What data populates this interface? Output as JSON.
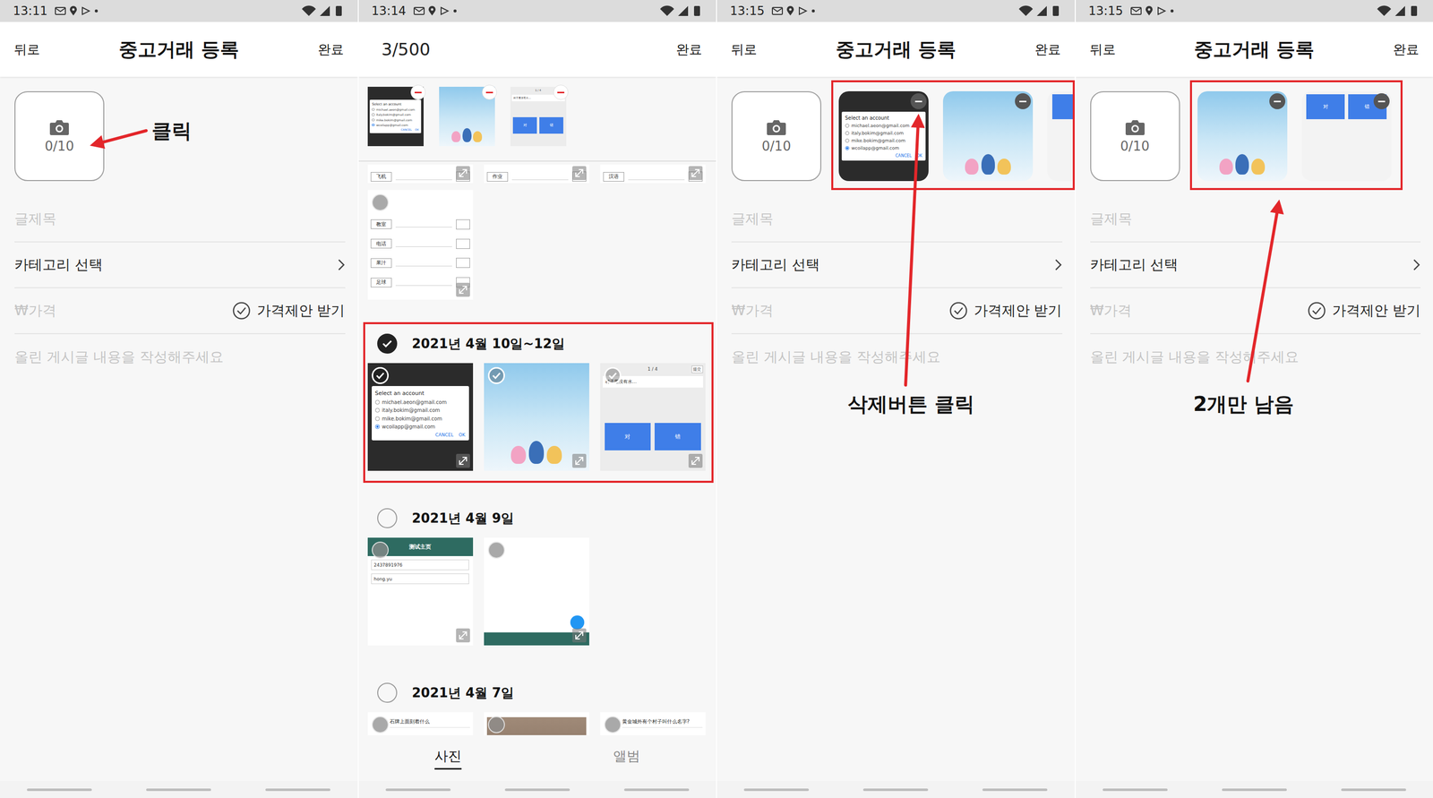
{
  "screens": [
    {
      "kind": "form",
      "status_time": "13:11",
      "header": {
        "back": "뒤로",
        "title": "중고거래 등록",
        "done": "완료"
      },
      "photo_button": {
        "count": "0/10"
      },
      "attached": {
        "highlighted": false,
        "items": []
      },
      "form": {
        "title_placeholder": "글제목",
        "category": "카테고리 선택",
        "price_placeholder": "₩가격",
        "offer": {
          "label": "가격제안 받기",
          "checked": false
        },
        "content_placeholder": "올린 게시글 내용을 작성해주세요"
      },
      "annotation": {
        "text": "클릭"
      }
    },
    {
      "kind": "picker",
      "status_time": "13:14",
      "header": {
        "count": "3/500",
        "done": "완료"
      },
      "selected_strip": [
        {
          "kind": "account",
          "title": "Select an account",
          "options": [
            {
              "label": "michael.aeon@gmail.com",
              "selected": false
            },
            {
              "label": "italy.bokim@gmail.com",
              "selected": false
            },
            {
              "label": "mike.bokim@gmail.com",
              "selected": false
            },
            {
              "label": "wcoilapp@gmail.com",
              "selected": true
            }
          ],
          "buttons": [
            "CANCEL",
            "OK"
          ]
        },
        {
          "kind": "image"
        },
        {
          "kind": "quiz",
          "page": "1 / 4",
          "submit": "提交",
          "question": "村子里没有水…",
          "answers": [
            "对",
            "错"
          ]
        }
      ],
      "partial_row": [
        {
          "kind": "words",
          "words": [
            "飞机"
          ]
        },
        {
          "kind": "words",
          "words": [
            "作业"
          ]
        },
        {
          "kind": "words",
          "words": [
            "汉语"
          ]
        }
      ],
      "tall_photo": {
        "kind": "words",
        "words": [
          "教室",
          "电话",
          "果汁",
          "足球"
        ],
        "selected": false
      },
      "groups": [
        {
          "title": "2021년 4월 10일~12일",
          "selected": true,
          "highlighted": true,
          "photos": [
            {
              "kind": "account",
              "title": "Select an account",
              "options": [
                {
                  "label": "michael.aeon@gmail.com",
                  "selected": false
                },
                {
                  "label": "italy.bokim@gmail.com",
                  "selected": false
                },
                {
                  "label": "mike.bokim@gmail.com",
                  "selected": false
                },
                {
                  "label": "wcoilapp@gmail.com",
                  "selected": true
                }
              ],
              "buttons": [
                "CANCEL",
                "OK"
              ],
              "selected": true
            },
            {
              "kind": "image",
              "selected": true
            },
            {
              "kind": "quiz",
              "page": "1 / 4",
              "submit": "提交",
              "question": "村子里没有水…",
              "answers": [
                "对",
                "错"
              ],
              "selected": true
            }
          ]
        },
        {
          "title": "2021년 4월 9일",
          "selected": false,
          "highlighted": false,
          "photos": [
            {
              "kind": "app-form",
              "title": "测试主页",
              "fields": [
                "2437891976",
                "hong.yu"
              ],
              "selected": false
            },
            {
              "kind": "app-blank",
              "selected": false
            }
          ]
        },
        {
          "title": "2021년 4월 7일",
          "selected": false,
          "highlighted": false,
          "photos": [
            {
              "kind": "question",
              "text": "石牌上面刻着什么",
              "selected": false
            },
            {
              "kind": "photo",
              "selected": false
            },
            {
              "kind": "question",
              "text": "黄金城外有个村子叫什么名字?",
              "selected": false
            }
          ]
        }
      ],
      "tabs": [
        {
          "label": "사진",
          "selected": true
        },
        {
          "label": "앨범",
          "selected": false
        }
      ]
    },
    {
      "kind": "form",
      "status_time": "13:15",
      "header": {
        "back": "뒤로",
        "title": "중고거래 등록",
        "done": "완료"
      },
      "photo_button": {
        "count": "0/10"
      },
      "attached": {
        "highlighted": true,
        "items": [
          {
            "kind": "account",
            "title": "Select an account",
            "options": [
              {
                "label": "michael.aeon@gmail.com",
                "selected": false
              },
              {
                "label": "italy.bokim@gmail.com",
                "selected": false
              },
              {
                "label": "mike.bokim@gmail.com",
                "selected": false
              },
              {
                "label": "wcoilapp@gmail.com",
                "selected": true
              }
            ],
            "buttons": [
              "CANCEL",
              "OK"
            ]
          },
          {
            "kind": "image"
          },
          {
            "kind": "quiz-edge"
          }
        ]
      },
      "form": {
        "title_placeholder": "글제목",
        "category": "카테고리 선택",
        "price_placeholder": "₩가격",
        "offer": {
          "label": "가격제안 받기",
          "checked": false
        },
        "content_placeholder": "올린 게시글 내용을 작성해주세요"
      },
      "annotation": {
        "text": "삭제버튼 클릭"
      }
    },
    {
      "kind": "form",
      "status_time": "13:15",
      "header": {
        "back": "뒤로",
        "title": "중고거래 등록",
        "done": "완료"
      },
      "photo_button": {
        "count": "0/10"
      },
      "attached": {
        "highlighted": true,
        "items": [
          {
            "kind": "image"
          },
          {
            "kind": "quiz",
            "answers": [
              "对",
              "错"
            ]
          }
        ]
      },
      "form": {
        "title_placeholder": "글제목",
        "category": "카테고리 선택",
        "price_placeholder": "₩가격",
        "offer": {
          "label": "가격제안 받기",
          "checked": false
        },
        "content_placeholder": "올린 게시글 내용을 작성해주세요"
      },
      "annotation": {
        "text": "2개만 남음"
      }
    }
  ]
}
